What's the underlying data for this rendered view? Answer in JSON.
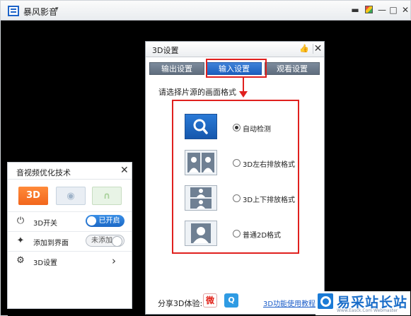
{
  "app": {
    "title": "暴风影音",
    "title_caret": "▾",
    "controls": {
      "chat": "▬",
      "min": "—",
      "max": "□",
      "close": "✕"
    }
  },
  "dialog": {
    "title": "3D设置",
    "pin_icon": "👍",
    "close": "✕",
    "tabs": [
      "输出设置",
      "输入设置",
      "观看设置"
    ],
    "active_tab": 1,
    "prompt": "请选择片源的画面格式",
    "options": [
      {
        "label": "自动检测",
        "icon": "search-icon",
        "selected": true
      },
      {
        "label": "3D左右排放格式",
        "icon": "side-by-side-icon",
        "selected": false
      },
      {
        "label": "3D上下排放格式",
        "icon": "top-bottom-icon",
        "selected": false
      },
      {
        "label": "普通2D格式",
        "icon": "person-icon",
        "selected": false
      }
    ],
    "share_label": "分享3D体验:",
    "share_weibo": "微",
    "share_tencent": "Q",
    "help_link": "3D功能使用教程",
    "highlight_color": "#e0201e"
  },
  "panel": {
    "title": "音视频优化技术",
    "close": "✕",
    "modes": [
      {
        "label": "3D",
        "icon": "3d-icon",
        "active": true
      },
      {
        "label": "◉",
        "icon": "eye-icon",
        "active": false
      },
      {
        "label": "∩",
        "icon": "headphones-icon",
        "active": false
      }
    ],
    "rows": [
      {
        "label": "3D开关",
        "icon": "power-icon",
        "glyph": "⏻",
        "toggle": "已开启"
      },
      {
        "label": "添加到界面",
        "icon": "pin-icon",
        "glyph": "✦",
        "toggle": "未添加"
      },
      {
        "label": "3D设置",
        "icon": "gear-icon",
        "glyph": "⚙",
        "chevron": "›"
      }
    ],
    "accent_color": "#f2661c",
    "toggle_color": "#1b68c6"
  },
  "watermark": {
    "text": "易采站长站",
    "subtext": "Www.Easck.Com Webmaster"
  }
}
